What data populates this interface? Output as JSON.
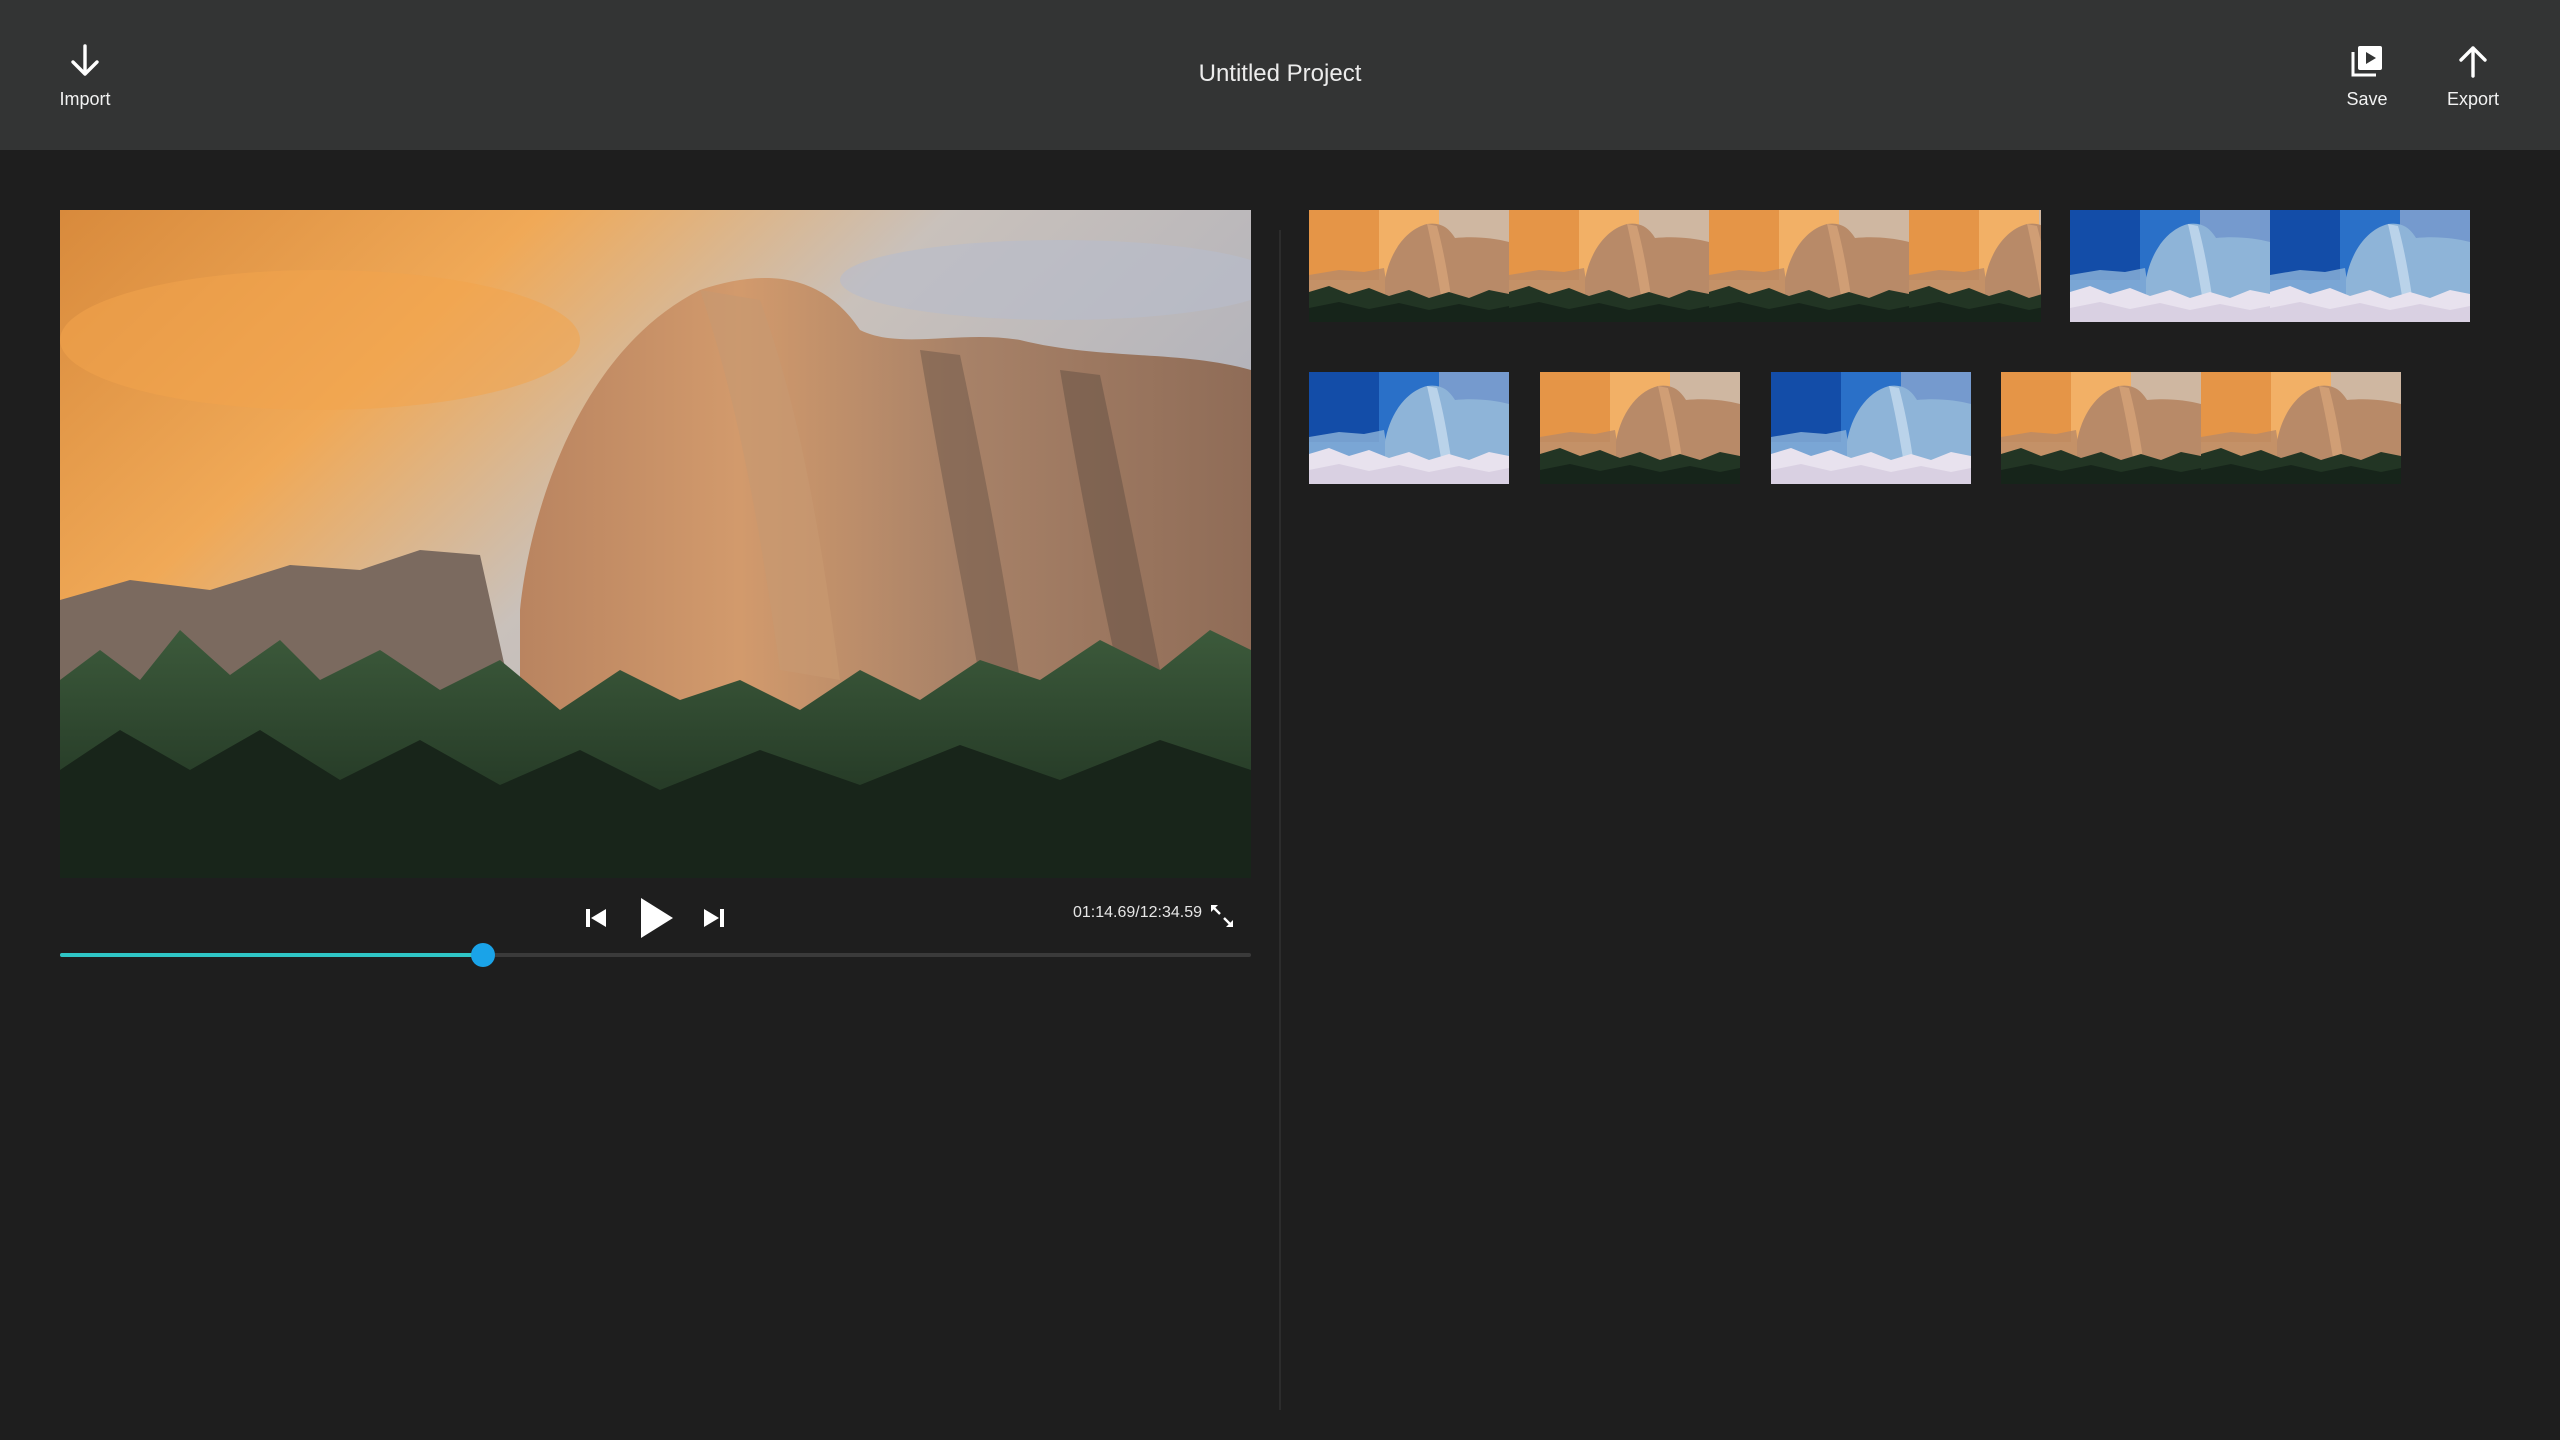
{
  "toolbar": {
    "import_label": "Import",
    "save_label": "Save",
    "export_label": "Export",
    "title": "Untitled Project"
  },
  "player": {
    "timecode": "01:14.69/12:34.59",
    "progress_fraction": 0.355
  },
  "colors": {
    "accent_fill": "#2fc6c6",
    "accent_thumb": "#1aa3e8",
    "topbar_bg": "#333434",
    "app_bg": "#1e1e1e"
  },
  "icons": {
    "import": "arrow-down-icon",
    "save": "save-video-icon",
    "export": "arrow-up-icon",
    "prev": "skip-previous-icon",
    "play": "play-icon",
    "next": "skip-next-icon",
    "fullscreen": "fullscreen-icon"
  },
  "timeline": {
    "clips": [
      {
        "style": "normal",
        "frames": 4
      },
      {
        "style": "inverted",
        "frames": 2
      },
      {
        "style": "inverted",
        "frames": 1
      },
      {
        "style": "normal",
        "frames": 1
      },
      {
        "style": "inverted",
        "frames": 1
      },
      {
        "style": "normal",
        "frames": 2
      }
    ]
  }
}
